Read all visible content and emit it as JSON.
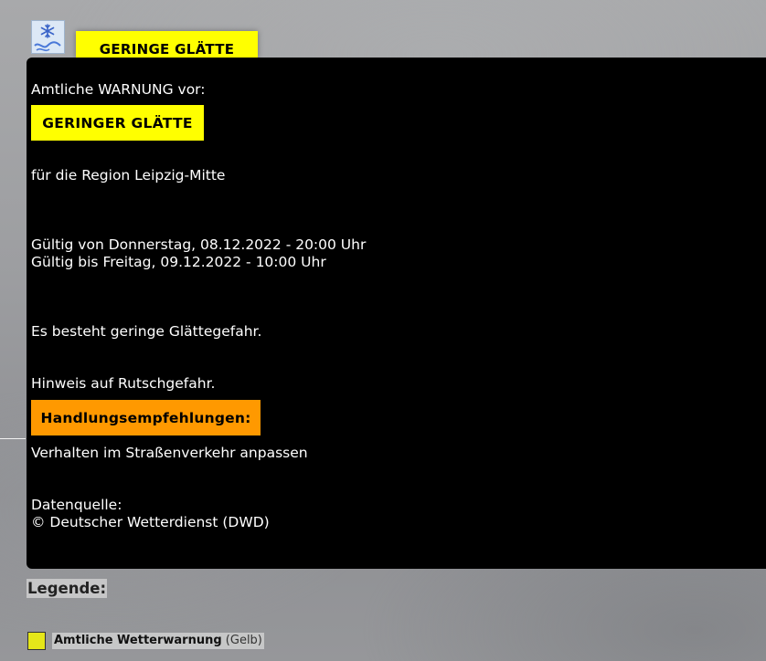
{
  "header": {
    "icon": "snow-ice-road-icon",
    "tab_label": "GERINGE GLÄTTE"
  },
  "warning": {
    "intro": "Amtliche WARNUNG vor:",
    "level_label": "GERINGER GLÄTTE",
    "region": "für die Region Leipzig-Mitte",
    "valid_from": "Gültig von Donnerstag, 08.12.2022 - 20:00 Uhr",
    "valid_to": "Gültig bis Freitag, 09.12.2022 - 10:00 Uhr",
    "description": "Es besteht geringe Glättegefahr.",
    "note": "Hinweis auf Rutschgefahr.",
    "actions_label": "Handlungsempfehlungen:",
    "actions_text": "Verhalten im Straßenverkehr anpassen",
    "source_label": "Datenquelle:",
    "source_text": "© Deutscher Wetterdienst (DWD)"
  },
  "legend": {
    "title": "Legende:",
    "entries": [
      {
        "label": "Amtliche Wetterwarnung",
        "qualifier": "(Gelb)",
        "color": "#e5e619"
      }
    ]
  },
  "colors": {
    "warning_yellow": "#ffff00",
    "action_orange": "#ff9900",
    "panel_background": "#000000"
  }
}
